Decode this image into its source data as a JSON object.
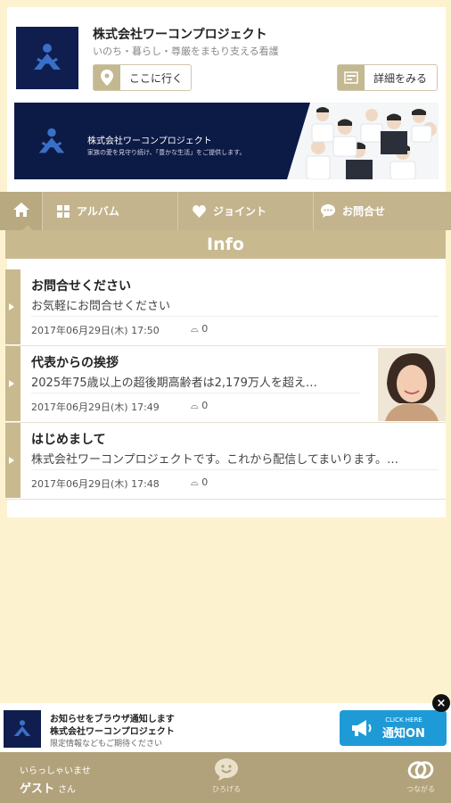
{
  "header": {
    "title": "株式会社ワーコンプロジェクト",
    "subtitle": "いのち・暮らし・尊厳をまもり支える看護",
    "go_label": "ここに行く",
    "detail_label": "詳細をみる"
  },
  "banner": {
    "title": "株式会社ワーコンプロジェクト",
    "tagline": "家族の愛を見守り続け、「豊かな生活」をご提供します。"
  },
  "tabs": [
    {
      "label": "アルバム",
      "icon": "grid-icon"
    },
    {
      "label": "ジョイント",
      "icon": "heart-icon"
    },
    {
      "label": "お問合せ",
      "icon": "chat-bubble-icon"
    }
  ],
  "info_header": "Info",
  "posts": [
    {
      "title": "お問合せください",
      "desc": "お気軽にお問合せください",
      "date": "2017年06月29日(木) 17:50",
      "comments": "0"
    },
    {
      "title": "代表からの挨拶",
      "desc": "2025年75歳以上の超後期高齢者は2,179万人を超え…",
      "date": "2017年06月29日(木) 17:49",
      "comments": "0"
    },
    {
      "title": "はじめまして",
      "desc": "株式会社ワーコンプロジェクトです。これから配信してまいります。…",
      "date": "2017年06月29日(木) 17:48",
      "comments": "0"
    }
  ],
  "notification": {
    "line1": "お知らせをブラウザ通知します",
    "line2": "株式会社ワーコンプロジェクト",
    "line3": "限定情報などもご期待ください",
    "button_small": "CLICK HERE",
    "button_main": "通知ON"
  },
  "footer": {
    "greeting": "いらっしゃいませ",
    "user": "ゲスト",
    "suffix": "さん",
    "center_label": "ひろげる",
    "right_label": "つながる"
  },
  "colors": {
    "gold": "#c4b48d",
    "navy": "#0f1e4e",
    "background": "#fdf2cf",
    "notify_blue": "#1e9bd7"
  }
}
